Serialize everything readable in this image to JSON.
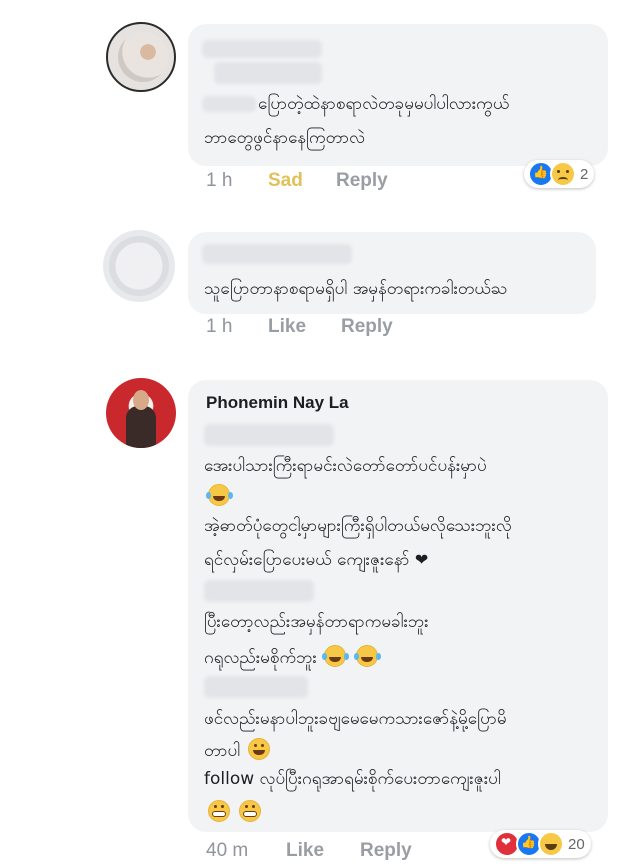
{
  "comments": [
    {
      "author": "",
      "lines": [
        "ပြောတဲ့ထဲနာစရာလဲတခုမှမပါပါလားကွယ်",
        "ဘာတွေဖွင်နာနေကြတာလဲ"
      ],
      "time": "1 h",
      "reaction_button": "Sad",
      "reply": "Reply",
      "reaction_count": "2",
      "reaction_icons": [
        "like-icon",
        "sad-icon"
      ]
    },
    {
      "author": "",
      "lines": [
        "သူပြောတာနာစရာမရှိပါ  အမှန်တရားကခါးတယ်ႀ"
      ],
      "time": "1 h",
      "reaction_button": "Like",
      "reply": "Reply"
    },
    {
      "author": "Phonemin Nay La",
      "lines": [
        "အေးပါသားကြီးရာမင်းလဲတော်တော်ပင်ပန်းမှာပဲ",
        "အဲ့ဓာတ်ပုံတွေငါ့မှာများကြီးရှိပါတယ်မလိုသေးဘူးလို",
        "ရင်လှမ်းပြောပေးမယ် ကျေးဇူးနော်",
        "ပြီးတော့လည်းအမှန်တာရာကမခါးဘူး",
        "ဂရုလည်းမစိုက်ဘူး",
        "ဖင်လည်းမနာပါဘူးခဗျမေမေကသားဇော်နဲ့မို့ပြောမိ",
        "တာပါ",
        "follow လုပ်ပြီးဂရုအာရမ်းစိုက်ပေးတာကျေးဇူးပါ"
      ],
      "time": "40 m",
      "reaction_button": "Like",
      "reply": "Reply",
      "reaction_count": "20",
      "reaction_icons": [
        "love-icon",
        "like-icon",
        "haha-icon"
      ]
    }
  ],
  "colors": {
    "bubble": "#f2f3f5",
    "meta_text": "#90949c",
    "sad_text": "#e0c15a",
    "like_blue": "#1877f2",
    "love_red": "#e0303c",
    "emoji_yellow": "#f7c845"
  }
}
